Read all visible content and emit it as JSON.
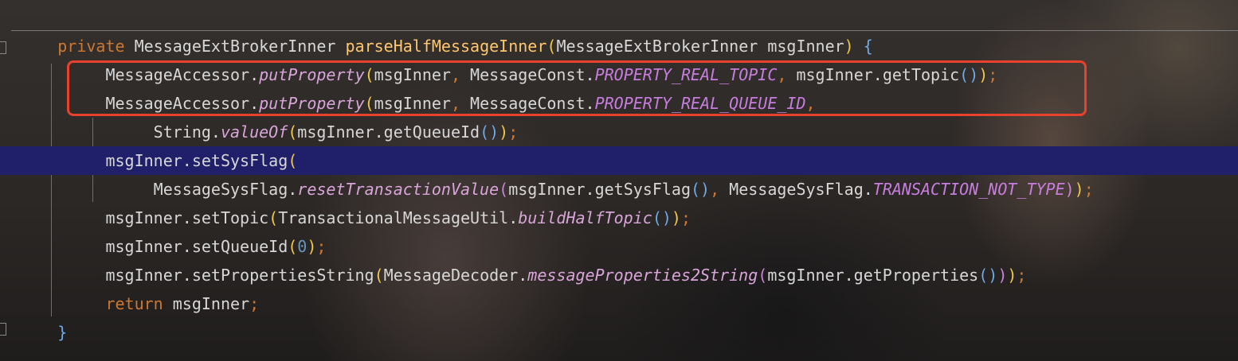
{
  "code": {
    "l1": {
      "kw": "private",
      "type": "MessageExtBrokerInner",
      "method": "parseHalfMessageInner",
      "open": "(",
      "param": "MessageExtBrokerInner msgInner",
      "close": ")",
      "brace": "{"
    },
    "l2": {
      "cls": "MessageAccessor.",
      "method": "putProperty",
      "open": "(",
      "a1": "msgInner",
      "comma1": ",",
      "cls2": "MessageConst.",
      "const": "PROPERTY_REAL_TOPIC",
      "comma2": ",",
      "call": "msgInner.getTopic",
      "p2o": "(",
      "p2c": ")",
      "close": ")",
      "semi": ";"
    },
    "l3": {
      "cls": "MessageAccessor.",
      "method": "putProperty",
      "open": "(",
      "a1": "msgInner",
      "comma1": ",",
      "cls2": "MessageConst.",
      "const": "PROPERTY_REAL_QUEUE_ID",
      "comma2": ","
    },
    "l4": {
      "cls": "String.",
      "method": "valueOf",
      "open": "(",
      "call": "msgInner.getQueueId",
      "p2o": "(",
      "p2c": ")",
      "close": ")",
      "semi": ";"
    },
    "l5": {
      "call": "msgInner.setSysFlag",
      "open": "("
    },
    "l6": {
      "cls": "MessageSysFlag.",
      "method": "resetTransactionValue",
      "open": "(",
      "call": "msgInner.getSysFlag",
      "p2o": "(",
      "p2c": ")",
      "comma": ",",
      "cls2": "MessageSysFlag.",
      "const": "TRANSACTION_NOT_TYPE",
      "close": ")",
      "semi": ";"
    },
    "l7": {
      "call": "msgInner.setTopic",
      "open": "(",
      "cls": "TransactionalMessageUtil.",
      "method": "buildHalfTopic",
      "p2o": "(",
      "p2c": ")",
      "close": ")",
      "semi": ";"
    },
    "l8": {
      "call": "msgInner.setQueueId",
      "open": "(",
      "num": "0",
      "close": ")",
      "semi": ";"
    },
    "l9": {
      "call": "msgInner.setPropertiesString",
      "open": "(",
      "cls": "MessageDecoder.",
      "method": "messageProperties2String",
      "p2o": "(",
      "call2": "msgInner.getProperties",
      "p3o": "(",
      "p3c": ")",
      "p2c": ")",
      "close": ")",
      "semi": ";"
    },
    "l10": {
      "kw": "return",
      "var": "msgInner",
      "semi": ";"
    },
    "l11": {
      "brace": "}"
    }
  },
  "colors": {
    "background": "#2b2b2b",
    "keyword": "#cc7832",
    "method_decl": "#ffc66d",
    "static_method": "#d9a5d9",
    "constant": "#c77dde",
    "line_highlight": "#20206a",
    "annotation_box": "#e8412e"
  }
}
